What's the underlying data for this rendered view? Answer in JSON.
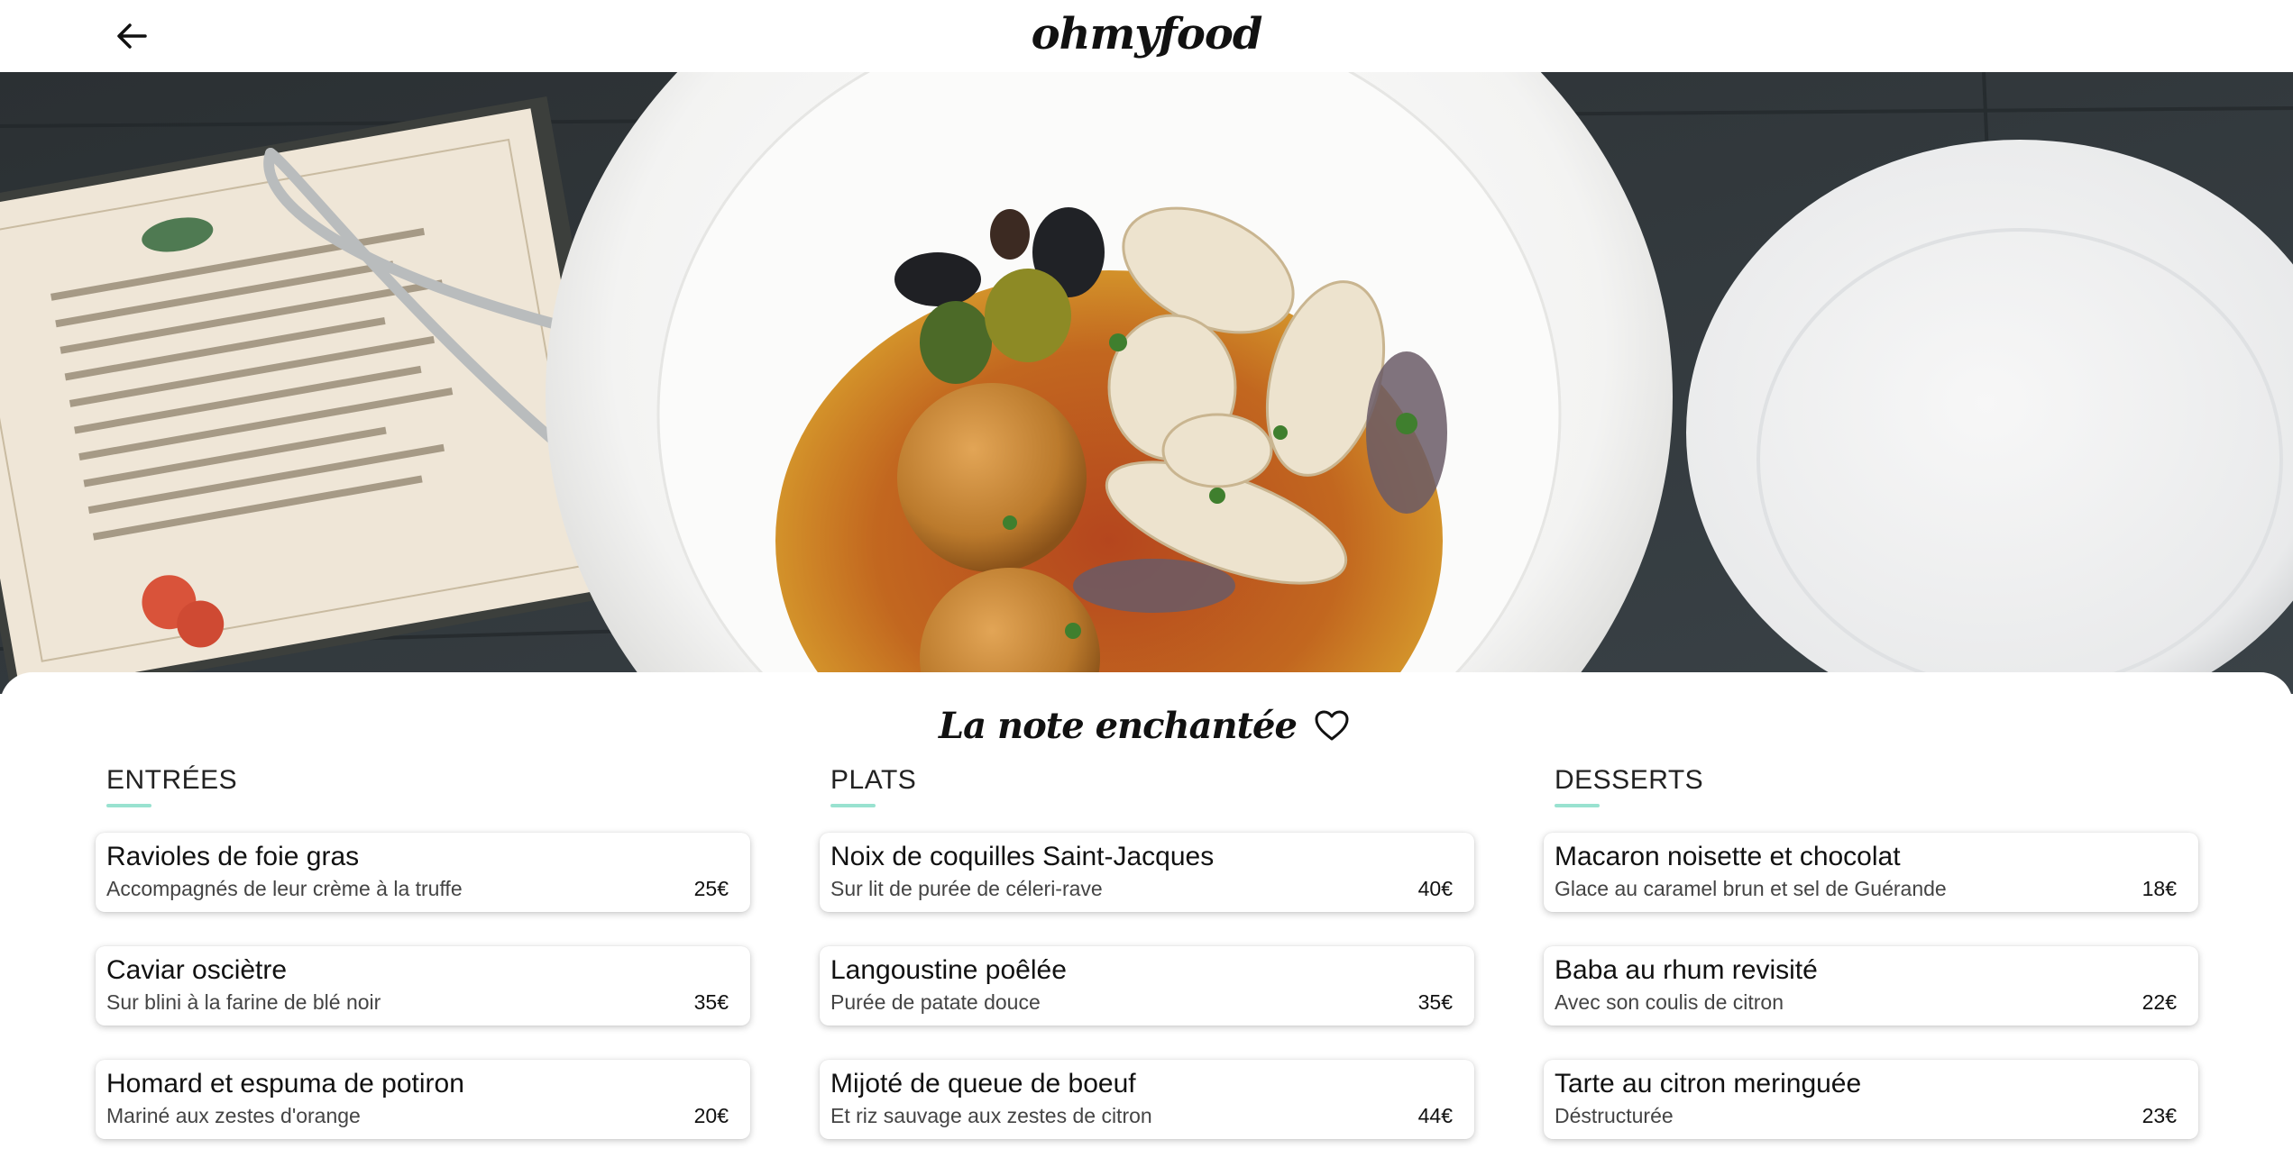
{
  "header": {
    "back_icon": "arrow-left-icon",
    "logo": "ohmyfood"
  },
  "hero": {
    "image": "overhead photo of a plate with fried squid, olives, arancini and tomato sauce next to a menu, tongs and an empty plate"
  },
  "restaurant": {
    "name": "La note enchantée",
    "favorite_icon": "heart-outline-icon"
  },
  "sections": [
    {
      "title": "ENTRÉES",
      "dishes": [
        {
          "name": "Ravioles de foie gras",
          "description": "Accompagnés de leur crème à la truffe",
          "price": "25€"
        },
        {
          "name": "Caviar osciètre",
          "description": "Sur blini à la farine de blé noir",
          "price": "35€"
        },
        {
          "name": "Homard et espuma de potiron",
          "description": "Mariné aux zestes d'orange",
          "price": "20€"
        }
      ]
    },
    {
      "title": "PLATS",
      "dishes": [
        {
          "name": "Noix de coquilles Saint-Jacques",
          "description": "Sur lit de purée de céleri-rave",
          "price": "40€"
        },
        {
          "name": "Langoustine poêlée",
          "description": "Purée de patate douce",
          "price": "35€"
        },
        {
          "name": "Mijoté de queue de boeuf",
          "description": "Et riz sauvage aux zestes de citron",
          "price": "44€"
        }
      ]
    },
    {
      "title": "DESSERTS",
      "dishes": [
        {
          "name": "Macaron noisette et chocolat",
          "description": "Glace au caramel brun et sel de Guérande",
          "price": "18€"
        },
        {
          "name": "Baba au rhum revisité",
          "description": "Avec son coulis de citron",
          "price": "22€"
        },
        {
          "name": "Tarte au citron meringuée",
          "description": "Déstructurée",
          "price": "23€"
        }
      ]
    }
  ],
  "colors": {
    "accent_underline": "#99e2d0",
    "text": "#111111",
    "background": "#ffffff"
  }
}
